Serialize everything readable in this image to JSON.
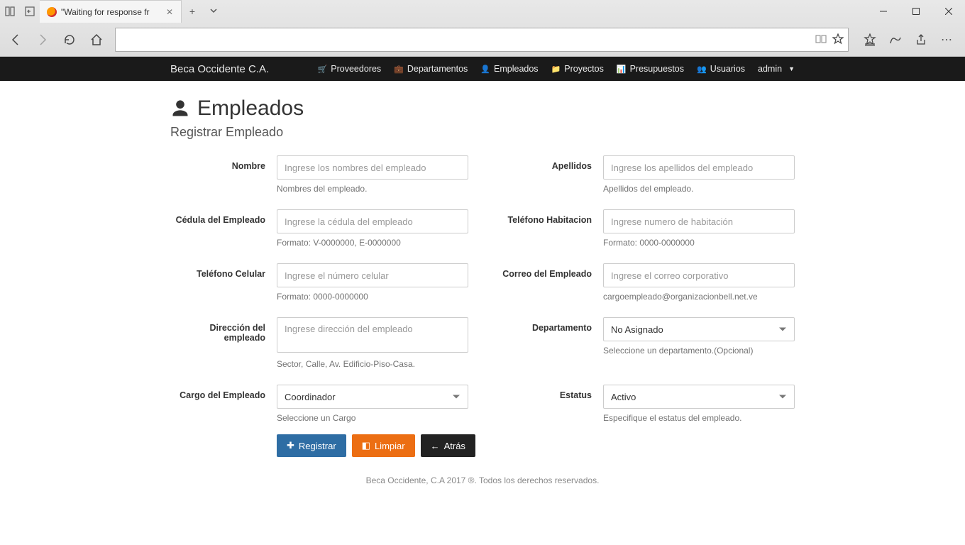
{
  "browser": {
    "tab_title": "\"Waiting for response fr"
  },
  "navbar": {
    "brand": "Beca Occidente C.A.",
    "links": {
      "proveedores": "Proveedores",
      "departamentos": "Departamentos",
      "empleados": "Empleados",
      "proyectos": "Proyectos",
      "presupuestos": "Presupuestos",
      "usuarios": "Usuarios",
      "admin": "admin"
    }
  },
  "page": {
    "title": "Empleados",
    "subtitle": "Registrar Empleado"
  },
  "form": {
    "nombre": {
      "label": "Nombre",
      "placeholder": "Ingrese los nombres del empleado",
      "help": "Nombres del empleado."
    },
    "apellidos": {
      "label": "Apellidos",
      "placeholder": "Ingrese los apellidos del empleado",
      "help": "Apellidos del empleado."
    },
    "cedula": {
      "label": "Cédula del Empleado",
      "placeholder": "Ingrese la cédula del empleado",
      "help": "Formato: V-0000000, E-0000000"
    },
    "tel_hab": {
      "label": "Teléfono Habitacion",
      "placeholder": "Ingrese numero de habitación",
      "help": "Formato: 0000-0000000"
    },
    "tel_cel": {
      "label": "Teléfono Celular",
      "placeholder": "Ingrese el número celular",
      "help": "Formato: 0000-0000000"
    },
    "correo": {
      "label": "Correo del Empleado",
      "placeholder": "Ingrese el correo corporativo",
      "help": "cargoempleado@organizacionbell.net.ve"
    },
    "direccion": {
      "label": "Dirección del empleado",
      "placeholder": "Ingrese dirección del empleado",
      "help": "Sector, Calle, Av. Edificio-Piso-Casa."
    },
    "departamento": {
      "label": "Departamento",
      "value": "No Asignado",
      "help": "Seleccione un departamento.(Opcional)"
    },
    "cargo": {
      "label": "Cargo del Empleado",
      "value": "Coordinador",
      "help": "Seleccione un Cargo"
    },
    "estatus": {
      "label": "Estatus",
      "value": "Activo",
      "help": "Especifique el estatus del empleado."
    }
  },
  "buttons": {
    "registrar": "Registrar",
    "limpiar": "Limpiar",
    "atras": "Atrás"
  },
  "footer": "Beca Occidente, C.A 2017 ®. Todos los derechos reservados."
}
